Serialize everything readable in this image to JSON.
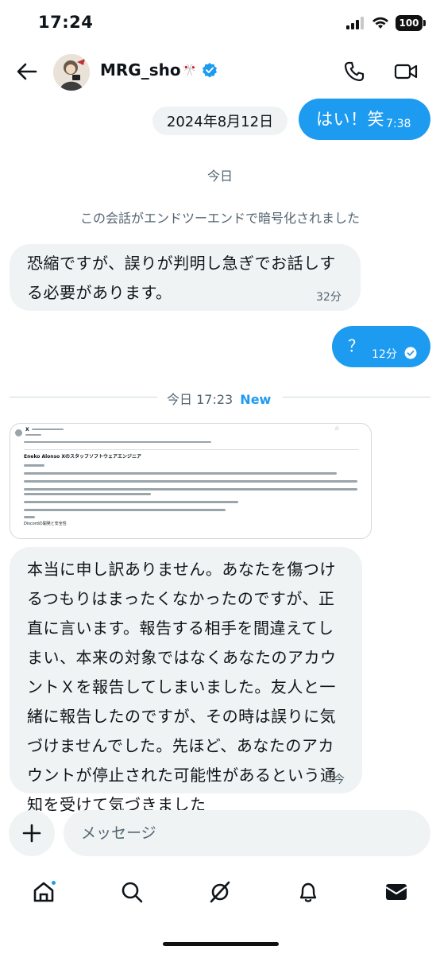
{
  "status_bar": {
    "time": "17:24",
    "battery": "100"
  },
  "header": {
    "name": "MRG_sho",
    "name_badge_emoji": "🎌",
    "icons": [
      "back-arrow-icon",
      "verified-badge-icon",
      "phone-icon",
      "video-icon"
    ]
  },
  "conversation": {
    "date_chip": "2024年8月12日",
    "outgoing_1": {
      "text": "はい！笑",
      "time": "7:38"
    },
    "today_label": "今日",
    "encryption_notice": "この会話がエンドツーエンドで暗号化されました",
    "incoming_1": {
      "lines": [
        "恐縮ですが、誤りが判明し急ぎでお話しす",
        "る必要があります。"
      ],
      "time": "32分"
    },
    "outgoing_2": {
      "text": "？",
      "time": "12分"
    },
    "new_divider": {
      "label": "今日 17:23",
      "badge": "New"
    },
    "image_message": {
      "sender": "X",
      "heading": "Eneko Alonso Xのスタッフソフトウェアエンジニア",
      "signoff": "Discordの開発と安全性"
    },
    "incoming_2": {
      "lines": [
        "本当に申し訳ありません。あなたを傷つけ",
        "るつもりはまったくなかったのですが、正",
        "直に言います。報告する相手を間違えてし",
        "まい、本来の対象ではなくあなたのアカウ",
        "ントＸを報告してしまいました。友人と一",
        "緒に報告したのですが、その時は誤りに気",
        "づけませんでした。先ほど、あなたのアカ",
        "ウントが停止された可能性があるという通",
        "知を受けて気づきました"
      ],
      "time": "今"
    }
  },
  "composer": {
    "placeholder": "メッセージ"
  },
  "nav": {
    "items": [
      "home-icon",
      "search-icon",
      "grok-icon",
      "notifications-icon",
      "messages-icon"
    ]
  },
  "colors": {
    "accent": "#1d9bf0",
    "bubble_in": "#eff3f4",
    "muted_text": "#536471"
  }
}
